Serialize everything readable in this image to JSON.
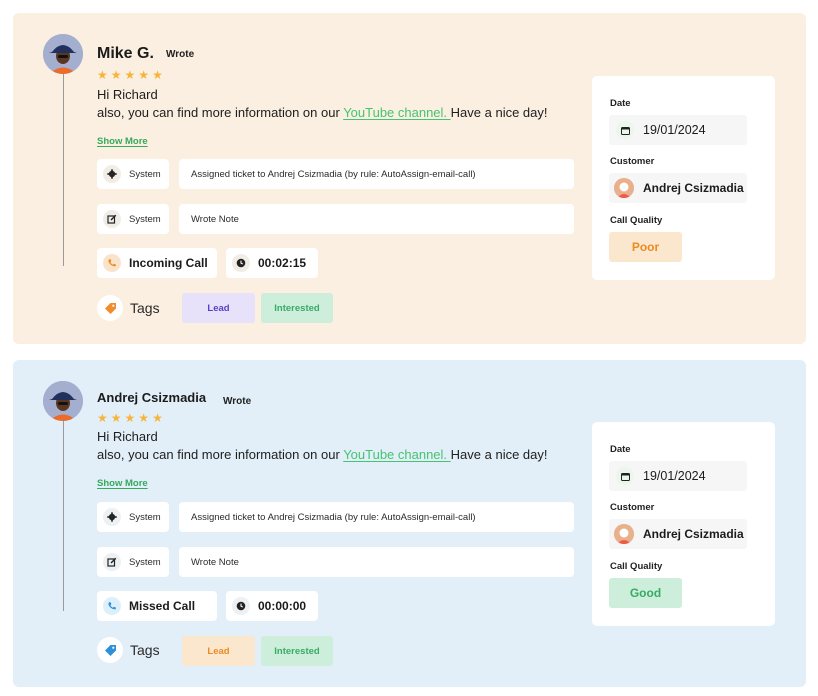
{
  "colors": {
    "card1_bg": "#faefe1",
    "card2_bg": "#e2eff9",
    "star": "#f6b53a",
    "link_green": "#44c46f",
    "lead_tag_bg_1": "#e7e1fa",
    "lead_tag_text_1": "#5c3fc7",
    "lead_tag_bg_2": "#fbe7cd",
    "lead_tag_text_2": "#ee8a22",
    "interested_tag_bg": "#cdeedb",
    "interested_tag_text": "#3aaa66",
    "poor_bg": "#fbe7cd",
    "poor_text": "#ee8a22",
    "good_bg": "#cdeedb",
    "good_text": "#3aaa66"
  },
  "cards": [
    {
      "author": "Mike G.",
      "wrote_label": "Wrote",
      "rating": 5,
      "greeting": "Hi Richard",
      "message_before": "also, you can find more information on our ",
      "message_link": "YouTube channel. ",
      "message_after": "Have a nice day!",
      "show_more": "Show More",
      "activities": [
        {
          "icon": "gear-icon",
          "actor": "System",
          "text": "Assigned ticket to Andrej Csizmadia (by rule: AutoAssign-email-call)"
        },
        {
          "icon": "note-icon",
          "actor": "System",
          "text": "Wrote Note"
        }
      ],
      "call": {
        "icon": "phone-incoming-icon",
        "label": "Incoming Call",
        "duration": "00:02:15"
      },
      "tags_label": "Tags",
      "tags": [
        "Lead",
        "Interested"
      ],
      "details": {
        "date_label": "Date",
        "date": "19/01/2024",
        "customer_label": "Customer",
        "customer": "Andrej Csizmadia",
        "quality_label": "Call Quality",
        "quality": "Poor"
      }
    },
    {
      "author": "Andrej Csizmadia",
      "wrote_label": "Wrote",
      "rating": 5,
      "greeting": "Hi Richard",
      "message_before": "also, you can find more information on our ",
      "message_link": "YouTube channel. ",
      "message_after": "Have a nice day!",
      "show_more": "Show More",
      "activities": [
        {
          "icon": "gear-icon",
          "actor": "System",
          "text": "Assigned ticket to Andrej Csizmadia (by rule: AutoAssign-email-call)"
        },
        {
          "icon": "note-icon",
          "actor": "System",
          "text": "Wrote Note"
        }
      ],
      "call": {
        "icon": "phone-missed-icon",
        "label": "Missed Call",
        "duration": "00:00:00"
      },
      "tags_label": "Tags",
      "tags": [
        "Lead",
        "Interested"
      ],
      "details": {
        "date_label": "Date",
        "date": "19/01/2024",
        "customer_label": "Customer",
        "customer": "Andrej Csizmadia",
        "quality_label": "Call Quality",
        "quality": "Good"
      }
    }
  ]
}
